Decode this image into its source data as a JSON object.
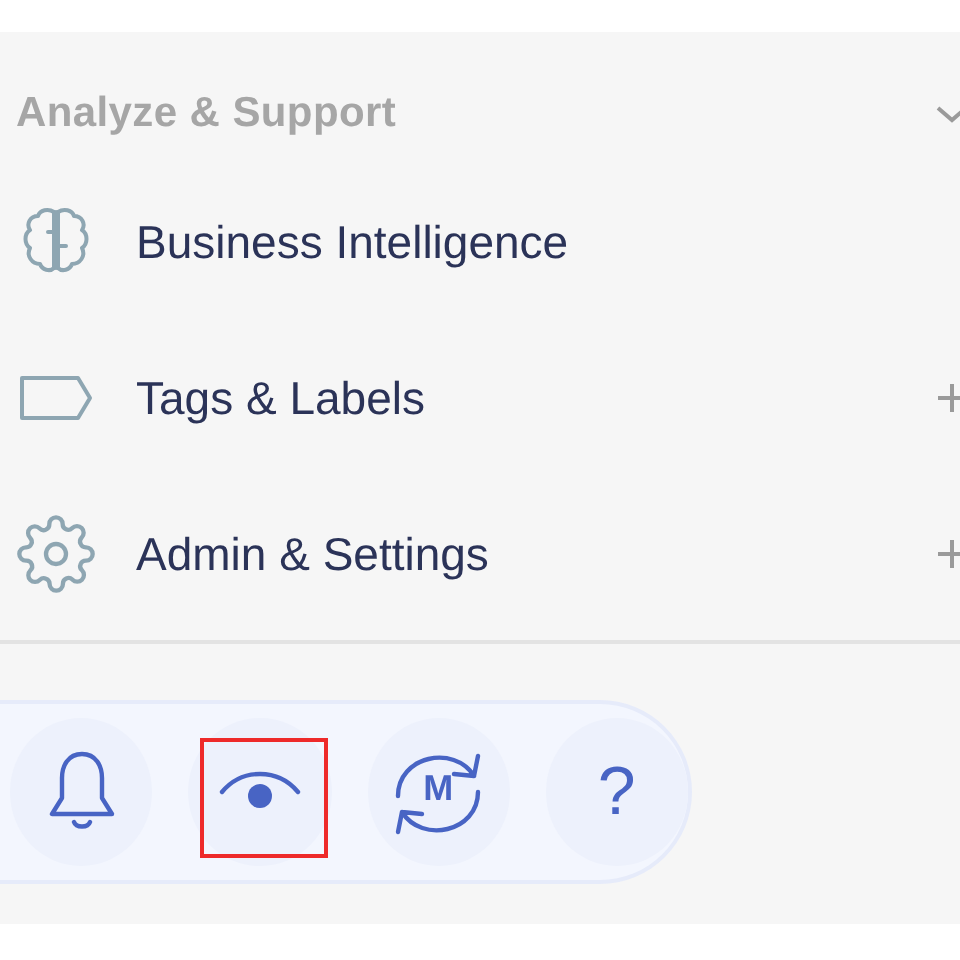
{
  "section": {
    "title": "Analyze & Support",
    "expanded": true
  },
  "items": [
    {
      "label": "Business Intelligence",
      "kind": "brain",
      "expandable": false
    },
    {
      "label": "Tags & Labels",
      "kind": "tag",
      "expandable": true
    },
    {
      "label": "Admin & Settings",
      "kind": "gear",
      "expandable": true
    }
  ],
  "quick_actions": [
    {
      "kind": "bell",
      "selected": false
    },
    {
      "kind": "eye",
      "selected": true
    },
    {
      "kind": "sync",
      "text": "M",
      "selected": false
    },
    {
      "kind": "help",
      "text": "?",
      "selected": false
    }
  ]
}
